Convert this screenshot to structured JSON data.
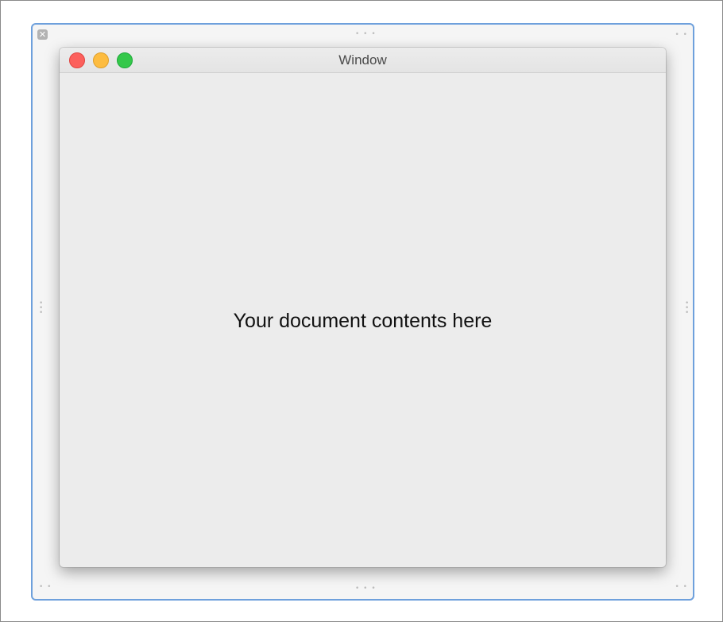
{
  "canvas": {
    "close_badge_glyph": "✕",
    "handle_horizontal_glyph": "• • •",
    "handle_vertical_glyph": "•\n•\n•",
    "handle_corner_glyph": "• •",
    "selection_color": "#6ea0dc"
  },
  "window": {
    "title": "Window",
    "traffic_lights": {
      "close_color": "#fc605c",
      "minimize_color": "#fdbc40",
      "zoom_color": "#34c84a"
    },
    "content_text": "Your document contents here"
  }
}
